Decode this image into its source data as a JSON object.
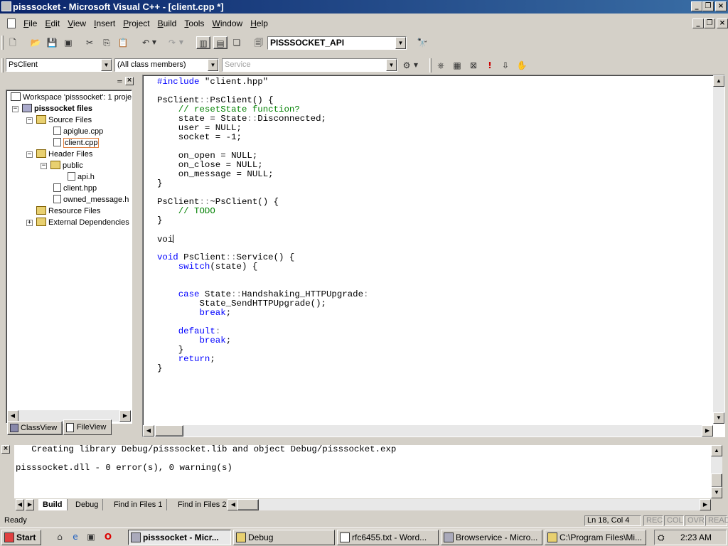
{
  "window": {
    "title": "pisssocket - Microsoft Visual C++ - [client.cpp *]"
  },
  "menu": {
    "items": [
      "File",
      "Edit",
      "View",
      "Insert",
      "Project",
      "Build",
      "Tools",
      "Window",
      "Help"
    ]
  },
  "toolbar": {
    "config_combo": "PISSSOCKET_API"
  },
  "wizardbar": {
    "class_combo": "PsClient",
    "members_combo": "(All class members)",
    "function_combo": "Service"
  },
  "workspace": {
    "tree": [
      {
        "label": "Workspace 'pisssocket': 1 proje",
        "type": "root"
      },
      {
        "label": "pisssocket files",
        "type": "project"
      },
      {
        "label": "Source Files",
        "type": "folder"
      },
      {
        "label": "apiglue.cpp",
        "type": "file"
      },
      {
        "label": "client.cpp",
        "type": "file"
      },
      {
        "label": "Header Files",
        "type": "folder"
      },
      {
        "label": "public",
        "type": "folder"
      },
      {
        "label": "api.h",
        "type": "file"
      },
      {
        "label": "client.hpp",
        "type": "file"
      },
      {
        "label": "owned_message.h",
        "type": "file"
      },
      {
        "label": "Resource Files",
        "type": "folder"
      },
      {
        "label": "External Dependencies",
        "type": "folder"
      }
    ],
    "tabs": [
      "ClassView",
      "FileView"
    ]
  },
  "editor": {
    "lines": [
      [
        [
          "kw",
          "#include"
        ],
        [
          "t",
          " \"client.hpp\""
        ]
      ],
      [
        [
          "t",
          ""
        ]
      ],
      [
        [
          "t",
          "PsClient"
        ],
        [
          "pu",
          "::"
        ],
        [
          "t",
          "PsClient() {"
        ]
      ],
      [
        [
          "t",
          "    "
        ],
        [
          "cm",
          "// resetState function?"
        ]
      ],
      [
        [
          "t",
          "    state = State"
        ],
        [
          "pu",
          "::"
        ],
        [
          "t",
          "Disconnected;"
        ]
      ],
      [
        [
          "t",
          "    user = NULL;"
        ]
      ],
      [
        [
          "t",
          "    socket = -1;"
        ]
      ],
      [
        [
          "t",
          ""
        ]
      ],
      [
        [
          "t",
          "    on_open = NULL;"
        ]
      ],
      [
        [
          "t",
          "    on_close = NULL;"
        ]
      ],
      [
        [
          "t",
          "    on_message = NULL;"
        ]
      ],
      [
        [
          "t",
          "}"
        ]
      ],
      [
        [
          "t",
          ""
        ]
      ],
      [
        [
          "t",
          "PsClient"
        ],
        [
          "pu",
          "::"
        ],
        [
          "t",
          "~PsClient() {"
        ]
      ],
      [
        [
          "t",
          "    "
        ],
        [
          "cm",
          "// TODO"
        ]
      ],
      [
        [
          "t",
          "}"
        ]
      ],
      [
        [
          "t",
          ""
        ]
      ],
      [
        [
          "t",
          "voi"
        ]
      ],
      [
        [
          "t",
          ""
        ]
      ],
      [
        [
          "kw",
          "void"
        ],
        [
          "t",
          " PsClient"
        ],
        [
          "pu",
          "::"
        ],
        [
          "t",
          "Service() {"
        ]
      ],
      [
        [
          "t",
          "    "
        ],
        [
          "kw",
          "switch"
        ],
        [
          "t",
          "(state) {"
        ]
      ],
      [
        [
          "t",
          ""
        ]
      ],
      [
        [
          "t",
          ""
        ]
      ],
      [
        [
          "t",
          "    "
        ],
        [
          "kw",
          "case"
        ],
        [
          "t",
          " State"
        ],
        [
          "pu",
          "::"
        ],
        [
          "t",
          "Handshaking_HTTPUpgrade"
        ],
        [
          "pu",
          ":"
        ]
      ],
      [
        [
          "t",
          "        State_SendHTTPUpgrade();"
        ]
      ],
      [
        [
          "t",
          "        "
        ],
        [
          "kw",
          "break"
        ],
        [
          "t",
          ";"
        ]
      ],
      [
        [
          "t",
          ""
        ]
      ],
      [
        [
          "t",
          "    "
        ],
        [
          "kw",
          "default"
        ],
        [
          "pu",
          ":"
        ]
      ],
      [
        [
          "t",
          "        "
        ],
        [
          "kw",
          "break"
        ],
        [
          "t",
          ";"
        ]
      ],
      [
        [
          "t",
          "    }"
        ]
      ],
      [
        [
          "t",
          "    "
        ],
        [
          "kw",
          "return"
        ],
        [
          "t",
          ";"
        ]
      ],
      [
        [
          "t",
          "}"
        ]
      ]
    ]
  },
  "output": {
    "lines": [
      "   Creating library Debug/pisssocket.lib and object Debug/pisssocket.exp",
      "",
      "pisssocket.dll - 0 error(s), 0 warning(s)"
    ],
    "tabs": [
      "Build",
      "Debug",
      "Find in Files 1",
      "Find in Files 2"
    ]
  },
  "status": {
    "text": "Ready",
    "position": "Ln 18, Col 4",
    "indicators": [
      "REC",
      "COL",
      "OVR",
      "READ"
    ]
  },
  "taskbar": {
    "start": "Start",
    "buttons": [
      "pisssocket - Micr...",
      "Debug",
      "rfc6455.txt - Word...",
      "Browservice - Micro...",
      "C:\\Program Files\\Mi..."
    ],
    "clock": "2:23 AM"
  }
}
